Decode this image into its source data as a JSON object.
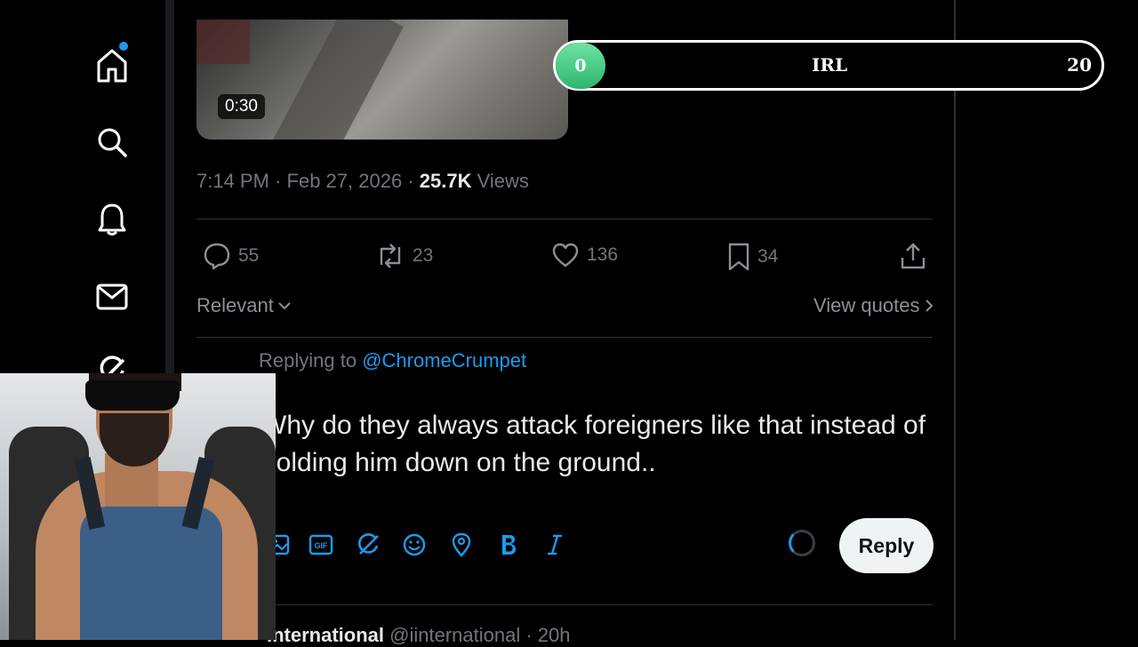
{
  "video": {
    "duration": "0:30"
  },
  "tweet_meta": {
    "time": "7:14 PM",
    "date": "Feb 27, 2026",
    "views_count": "25.7K",
    "views_label": "Views"
  },
  "actions": {
    "replies": "55",
    "reposts": "23",
    "likes": "136",
    "bookmarks": "34"
  },
  "sort": {
    "label": "Relevant"
  },
  "quotes": {
    "label": "View quotes"
  },
  "reply_composer": {
    "replying_prefix": "Replying to",
    "replying_handle": "@ChromeCrumpet",
    "text": "Why do they always attack foreigners like that instead of holding him down on the ground..",
    "reply_button": "Reply"
  },
  "next_reply": {
    "name": "International",
    "handle": "@iinternational · 20h"
  },
  "progress_overlay": {
    "min": "0",
    "label": "IRL",
    "max": "20",
    "value": 0
  },
  "colors": {
    "accent": "#1d9bf0",
    "background": "#000000",
    "progress_green": "#3ccf84"
  }
}
